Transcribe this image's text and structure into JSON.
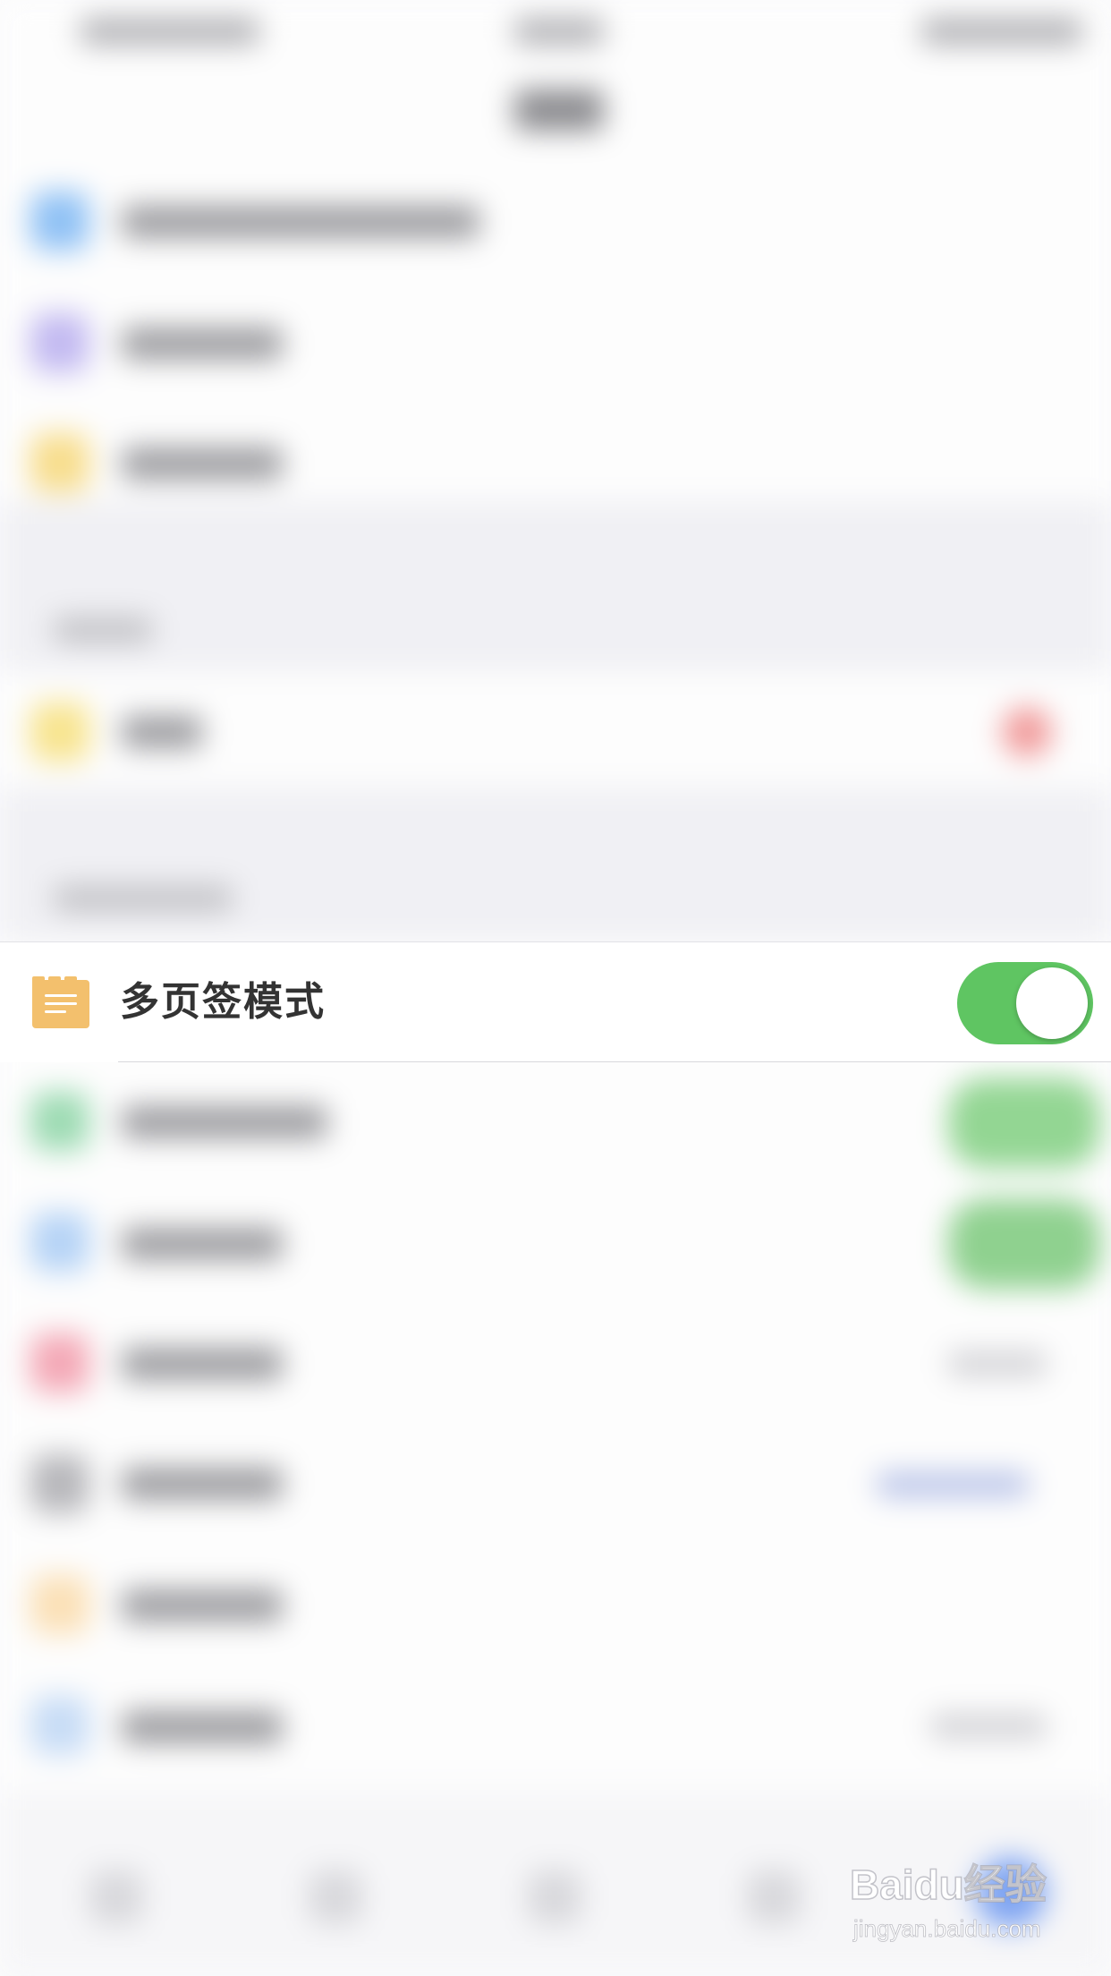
{
  "setting_row": {
    "label": "多页签模式",
    "icon": "tabs-folder-icon",
    "toggle_on": true
  },
  "colors": {
    "toggle_on": "#5fc562",
    "icon_orange": "#f3c06d",
    "label_text": "#333333"
  },
  "watermark": {
    "brand": "Baidu经验",
    "url": "jingyan.baidu.com"
  }
}
